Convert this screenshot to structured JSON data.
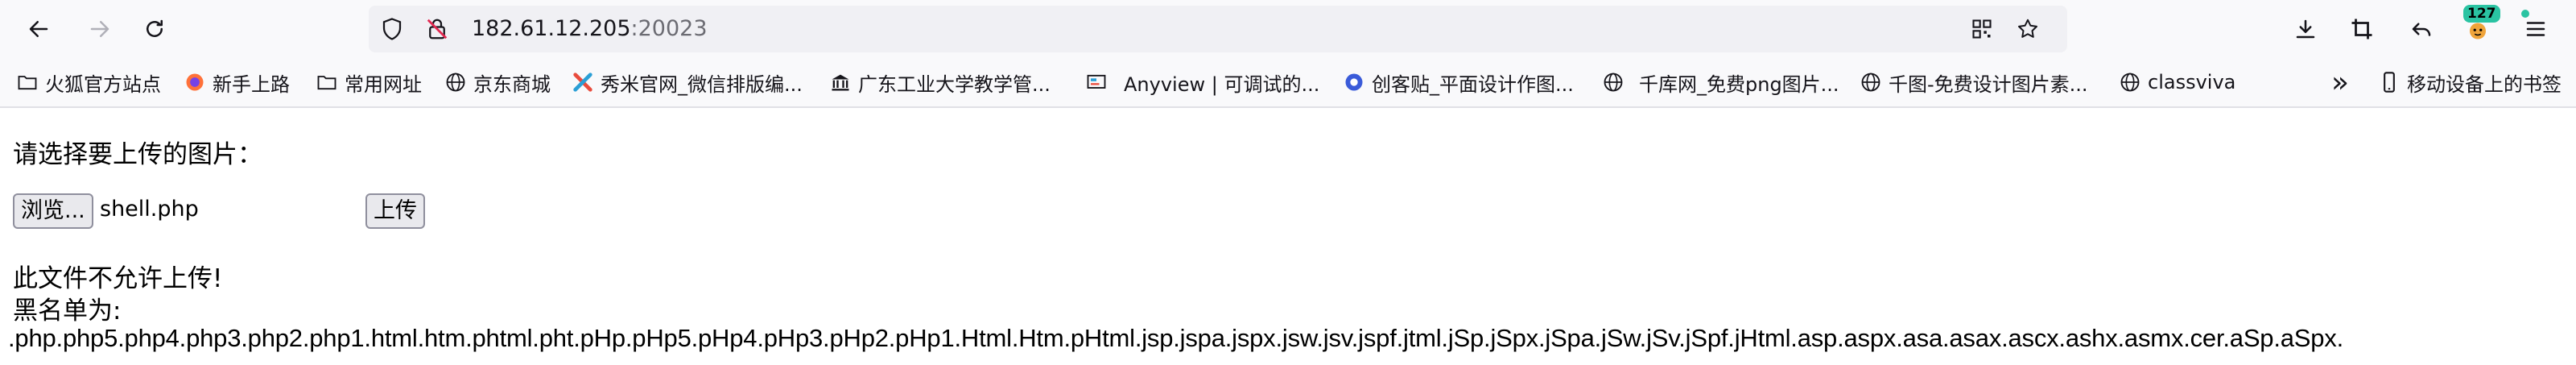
{
  "browser": {
    "url_host": "182.61.12.205",
    "url_port": ":20023",
    "badge_count": "127",
    "bookmarks": [
      {
        "label": "火狐官方站点",
        "icon": "folder-icon"
      },
      {
        "label": "新手上路",
        "icon": "firefox-icon"
      },
      {
        "label": "常用网址",
        "icon": "folder-icon"
      },
      {
        "label": "京东商城",
        "icon": "globe-icon"
      },
      {
        "label": "秀米官网_微信排版编...",
        "icon": "xiumi-icon"
      },
      {
        "label": "广东工业大学教学管...",
        "icon": "university-icon"
      },
      {
        "label": "Anyview | 可调试的...",
        "icon": "anyview-icon"
      },
      {
        "label": "创客贴_平面设计作图...",
        "icon": "chuangkit-icon"
      },
      {
        "label": "千库网_免费png图片...",
        "icon": "globe-icon"
      },
      {
        "label": "千图-免费设计图片素...",
        "icon": "globe-icon"
      },
      {
        "label": "classviva",
        "icon": "globe-icon"
      }
    ],
    "overflow_label": "»",
    "mobile_bookmarks": "移动设备上的书签"
  },
  "page": {
    "prompt": "请选择要上传的图片：",
    "browse_button": "浏览...",
    "selected_file": "shell.php",
    "upload_button": "上传",
    "error_message": "此文件不允许上传!",
    "blacklist_label": "黑名单为:",
    "blacklist_text": ".php.php5.php4.php3.php2.php1.html.htm.phtml.pht.pHp.pHp5.pHp4.pHp3.pHp2.pHp1.Html.Htm.pHtml.jsp.jspa.jspx.jsw.jsv.jspf.jtml.jSp.jSpx.jSpa.jSw.jSv.jSpf.jHtml.asp.aspx.asa.asax.ascx.ashx.asmx.cer.aSp.aSpx."
  },
  "colors": {
    "toolbar_bg": "#f9f9fb",
    "urlbar_bg": "#f0f0f4",
    "badge_bg": "#2ac3a2",
    "security_warning": "#e22850"
  }
}
